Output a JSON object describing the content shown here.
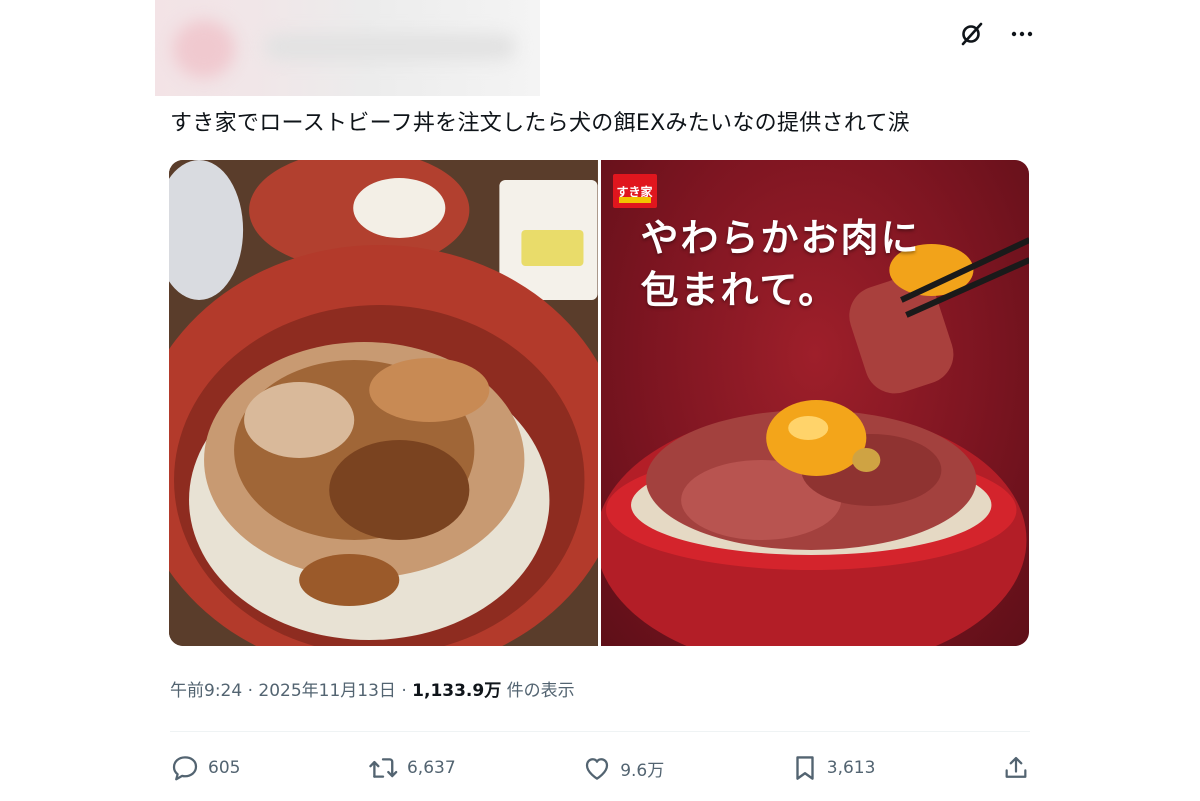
{
  "tweet": {
    "text": "すき家でローストビーフ丼を注文したら犬の餌EXみたいなの提供されて涙",
    "time": "午前9:24",
    "separator": "·",
    "date": "2025年11月13日",
    "views_count": "1,133.9万",
    "views_label": "件の表示"
  },
  "media": {
    "ad_logo_text": "すき家",
    "ad_copy_line1": "やわらかお肉に",
    "ad_copy_line2": "包まれて。"
  },
  "actions": {
    "replies": "605",
    "retweets": "6,637",
    "likes": "9.6万",
    "bookmarks": "3,613"
  },
  "icons": {
    "grok": "grok-icon",
    "more": "more-icon",
    "reply": "reply-icon",
    "retweet": "retweet-icon",
    "like": "like-icon",
    "bookmark": "bookmark-icon",
    "share": "share-icon"
  },
  "colors": {
    "text": "#0f1419",
    "secondary": "#536471",
    "brand_red": "#e0161e"
  }
}
